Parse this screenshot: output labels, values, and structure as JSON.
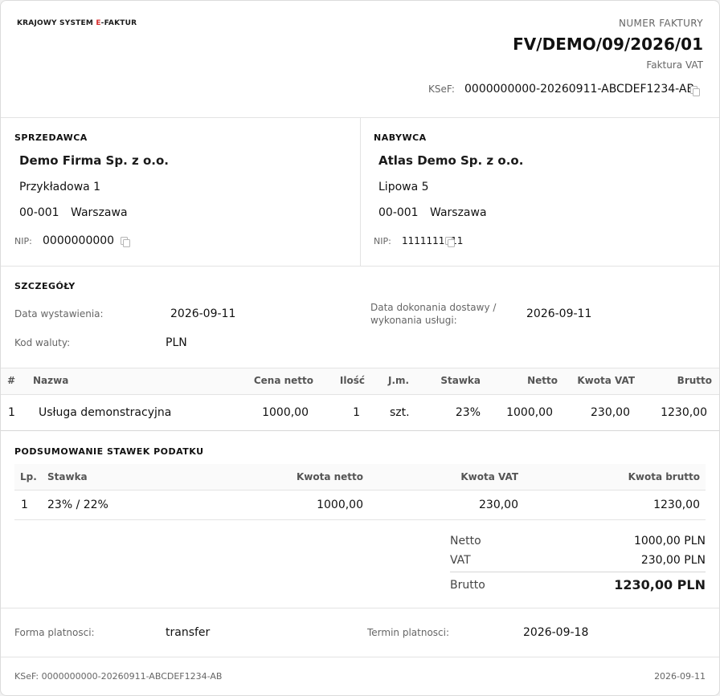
{
  "header": {
    "brand_prefix": "KRAJOWY SYSTEM ",
    "brand_accent": "E",
    "brand_suffix": "-FAKTUR",
    "invoice_number_label": "NUMER FAKTURY",
    "invoice_number": "FV/DEMO/09/2026/01",
    "invoice_type": "Faktura VAT",
    "ksef_label": "KSeF:",
    "ksef_number": "0000000000-20260911-ABCDEF1234-AB"
  },
  "seller": {
    "section_title": "SPRZEDAWCA",
    "name": "Demo Firma Sp. z o.o.",
    "street": "Przykładowa 1",
    "postal_code": "00-001",
    "city": "Warszawa",
    "nip_label": "NIP:",
    "nip": "0000000000"
  },
  "buyer": {
    "section_title": "NABYWCA",
    "name": "Atlas Demo Sp. z o.o.",
    "street": "Lipowa 5",
    "postal_code": "00-001",
    "city": "Warszawa",
    "nip_label": "NIP:",
    "nip": "1111111111"
  },
  "details": {
    "section_title": "SZCZEGÓŁY",
    "issue_date_label": "Data wystawienia:",
    "issue_date": "2026-09-11",
    "delivery_date_label_1": "Data dokonania dostawy /",
    "delivery_date_label_2": "wykonania usługi:",
    "delivery_date": "2026-09-11",
    "currency_label": "Kod waluty:",
    "currency": "PLN"
  },
  "items": {
    "headers": {
      "no": "#",
      "name": "Nazwa",
      "unit_price": "Cena netto",
      "qty": "Ilość",
      "unit": "J.m.",
      "rate": "Stawka",
      "net": "Netto",
      "vat": "Kwota VAT",
      "gross": "Brutto"
    },
    "rows": [
      {
        "no": "1",
        "name": "Usługa demonstracyjna",
        "unit_price": "1000,00",
        "qty": "1",
        "unit": "szt.",
        "rate": "23%",
        "net": "1000,00",
        "vat": "230,00",
        "gross": "1230,00"
      }
    ]
  },
  "tax_summary": {
    "section_title": "PODSUMOWANIE STAWEK PODATKU",
    "headers": {
      "lp": "Lp.",
      "rate": "Stawka",
      "net": "Kwota netto",
      "vat": "Kwota VAT",
      "gross": "Kwota brutto"
    },
    "rows": [
      {
        "lp": "1",
        "rate": "23% / 22%",
        "net": "1000,00",
        "vat": "230,00",
        "gross": "1230,00"
      }
    ]
  },
  "totals": {
    "net_label": "Netto",
    "net": "1000,00 PLN",
    "vat_label": "VAT",
    "vat": "230,00 PLN",
    "gross_label": "Brutto",
    "gross": "1230,00 PLN"
  },
  "payment": {
    "method_label": "Forma platnosci:",
    "method": "transfer",
    "due_label": "Termin platnosci:",
    "due_date": "2026-09-18"
  },
  "footer": {
    "ksef": "KSeF: 0000000000-20260911-ABCDEF1234-AB",
    "date": "2026-09-11"
  }
}
